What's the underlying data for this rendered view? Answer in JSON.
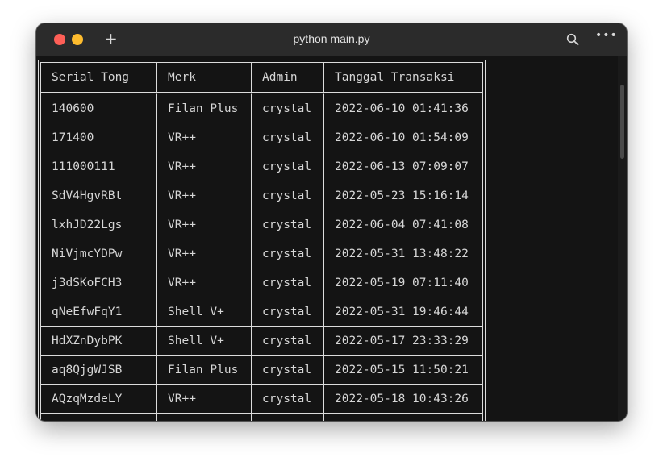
{
  "window": {
    "title": "python main.py"
  },
  "table": {
    "headers": [
      "Serial Tong",
      "Merk",
      "Admin",
      "Tanggal Transaksi"
    ],
    "rows": [
      [
        "140600",
        "Filan Plus",
        "crystal",
        "2022-06-10 01:41:36"
      ],
      [
        "171400",
        "VR++",
        "crystal",
        "2022-06-10 01:54:09"
      ],
      [
        "111000111",
        "VR++",
        "crystal",
        "2022-06-13 07:09:07"
      ],
      [
        "SdV4HgvRBt",
        "VR++",
        "crystal",
        "2022-05-23 15:16:14"
      ],
      [
        "lxhJD22Lgs",
        "VR++",
        "crystal",
        "2022-06-04 07:41:08"
      ],
      [
        "NiVjmcYDPw",
        "VR++",
        "crystal",
        "2022-05-31 13:48:22"
      ],
      [
        "j3dSKoFCH3",
        "VR++",
        "crystal",
        "2022-05-19 07:11:40"
      ],
      [
        "qNeEfwFqY1",
        "Shell V+",
        "crystal",
        "2022-05-31 19:46:44"
      ],
      [
        "HdXZnDybPK",
        "Shell V+",
        "crystal",
        "2022-05-17 23:33:29"
      ],
      [
        "aq8QjgWJSB",
        "Filan Plus",
        "crystal",
        "2022-05-15 11:50:21"
      ],
      [
        "AQzqMzdeLY",
        "VR++",
        "crystal",
        "2022-05-18 10:43:26"
      ],
      [
        "",
        "",
        "",
        ""
      ]
    ]
  },
  "colors": {
    "close": "#fe5f57",
    "minimize": "#febc2e",
    "background": "#141414",
    "titlebar": "#2b2b2b"
  },
  "icons": [
    "close-icon",
    "minimize-icon",
    "plus-icon",
    "search-icon",
    "more-icon"
  ]
}
